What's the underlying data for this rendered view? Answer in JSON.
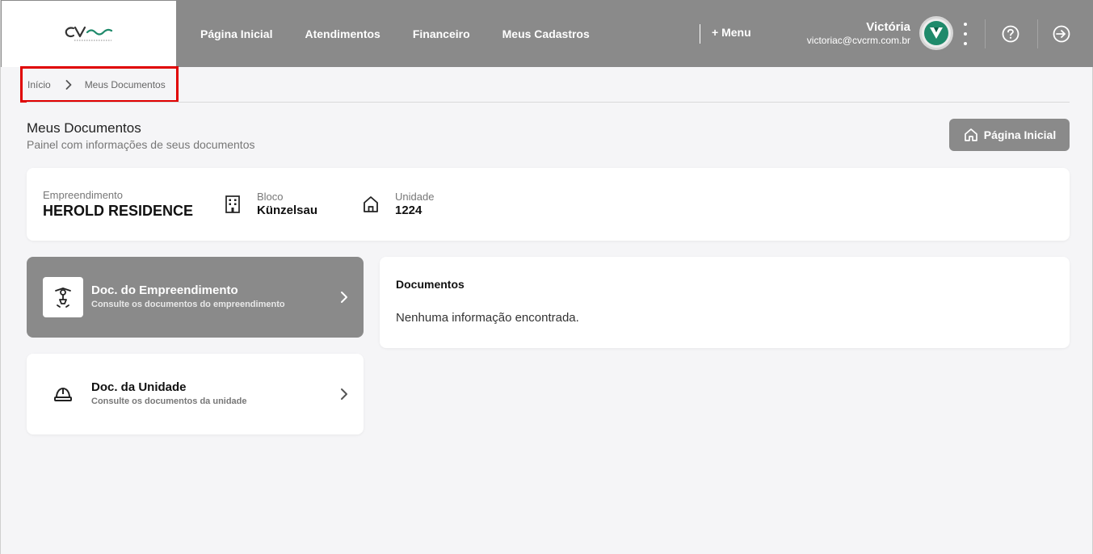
{
  "header": {
    "logo_name": "cvcrm-logo",
    "nav": [
      "Página Inicial",
      "Atendimentos",
      "Financeiro",
      "Meus Cadastros"
    ],
    "more_menu": "+ Menu",
    "user": {
      "name": "Victória",
      "email": "victoriac@cvcrm.com.br",
      "avatar_letter": "V"
    }
  },
  "breadcrumb": {
    "home": "Início",
    "current": "Meus Documentos"
  },
  "page": {
    "title": "Meus Documentos",
    "subtitle": "Painel com informações de seus documentos",
    "home_button": "Página Inicial"
  },
  "info": {
    "empreendimento_label": "Empreendimento",
    "empreendimento_value": "HEROLD RESIDENCE",
    "bloco_label": "Bloco",
    "bloco_value": "Künzelsau",
    "unidade_label": "Unidade",
    "unidade_value": "1224"
  },
  "doc_options": [
    {
      "title": "Doc. do Empreendimento",
      "description": "Consulte os documentos do empreendimento",
      "active": true
    },
    {
      "title": "Doc. da Unidade",
      "description": "Consulte os documentos da unidade",
      "active": false
    }
  ],
  "documents_panel": {
    "title": "Documentos",
    "empty_message": "Nenhuma informação encontrada."
  },
  "colors": {
    "header_gray": "#8a8a8a",
    "accent_green": "#1f8a6b",
    "highlight_red": "#e00000"
  }
}
